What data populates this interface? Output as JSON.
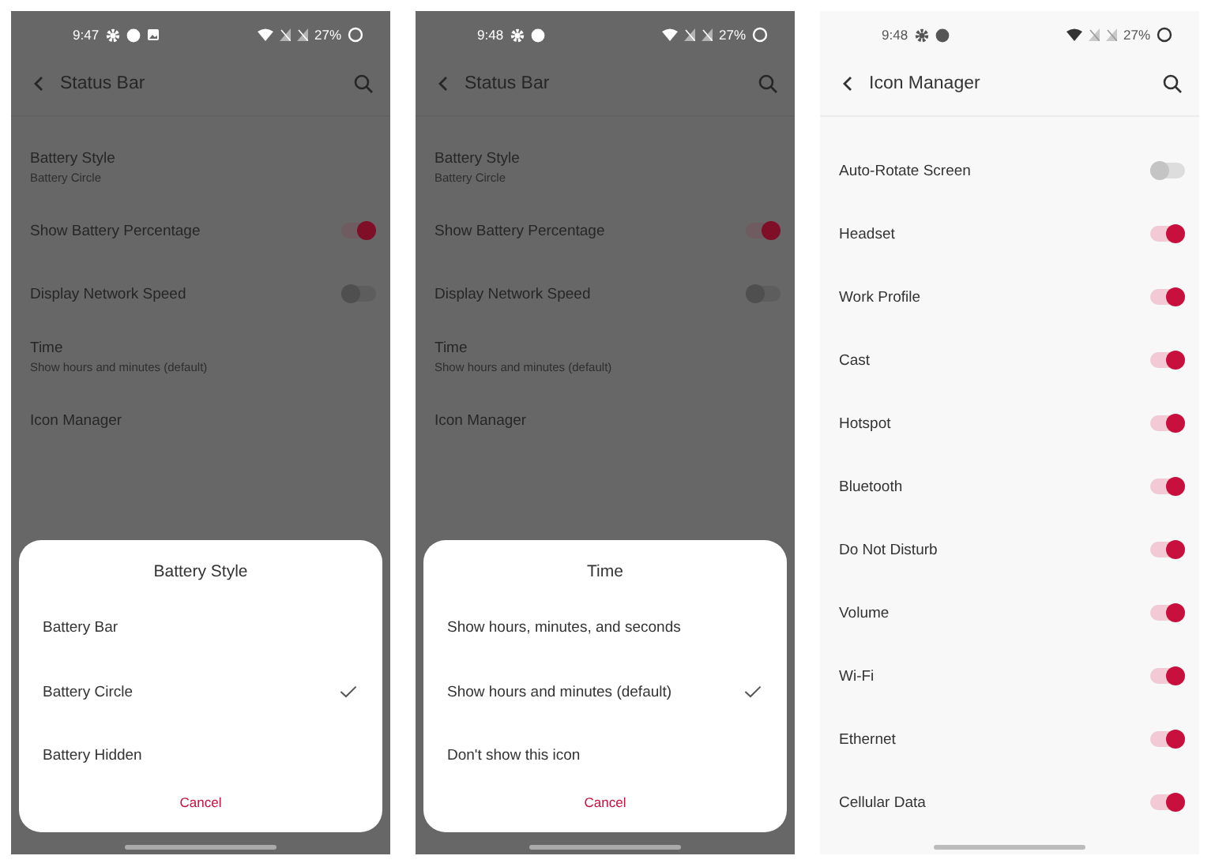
{
  "screens": [
    {
      "dimmed": true,
      "status_bar": {
        "time": "9:47",
        "notification_icons": [
          {
            "kind": "gear"
          },
          {
            "kind": "dot"
          },
          {
            "kind": "image"
          }
        ],
        "battery": "27%"
      },
      "header": {
        "title": "Status Bar"
      },
      "settings": [
        {
          "kind": "text",
          "label": "Battery Style",
          "summary": "Battery Circle"
        },
        {
          "kind": "switch",
          "label": "Show Battery Percentage",
          "on": true
        },
        {
          "kind": "switch",
          "label": "Display Network Speed",
          "on": false
        },
        {
          "kind": "text",
          "label": "Time",
          "summary": "Show hours and minutes (default)"
        },
        {
          "kind": "text",
          "label": "Icon Manager"
        }
      ],
      "dialog": {
        "title": "Battery Style",
        "options": [
          {
            "label": "Battery Bar",
            "selected": false
          },
          {
            "label": "Battery Circle",
            "selected": true
          },
          {
            "label": "Battery Hidden",
            "selected": false
          }
        ],
        "cancel": "Cancel"
      }
    },
    {
      "dimmed": true,
      "status_bar": {
        "time": "9:48",
        "notification_icons": [
          {
            "kind": "gear"
          },
          {
            "kind": "dot"
          }
        ],
        "battery": "27%"
      },
      "header": {
        "title": "Status Bar"
      },
      "settings": [
        {
          "kind": "text",
          "label": "Battery Style",
          "summary": "Battery Circle"
        },
        {
          "kind": "switch",
          "label": "Show Battery Percentage",
          "on": true
        },
        {
          "kind": "switch",
          "label": "Display Network Speed",
          "on": false
        },
        {
          "kind": "text",
          "label": "Time",
          "summary": "Show hours and minutes (default)"
        },
        {
          "kind": "text",
          "label": "Icon Manager"
        }
      ],
      "dialog": {
        "title": "Time",
        "options": [
          {
            "label": "Show hours, minutes, and seconds",
            "selected": false
          },
          {
            "label": "Show hours and minutes (default)",
            "selected": true
          },
          {
            "label": "Don't show this icon",
            "selected": false
          }
        ],
        "cancel": "Cancel"
      }
    },
    {
      "dimmed": false,
      "status_bar": {
        "time": "9:48",
        "notification_icons": [
          {
            "kind": "gear"
          },
          {
            "kind": "dot"
          }
        ],
        "battery": "27%"
      },
      "header": {
        "title": "Icon Manager"
      },
      "settings": [
        {
          "kind": "switch",
          "label": "Auto-Rotate Screen",
          "on": false
        },
        {
          "kind": "switch",
          "label": "Headset",
          "on": true
        },
        {
          "kind": "switch",
          "label": "Work Profile",
          "on": true
        },
        {
          "kind": "switch",
          "label": "Cast",
          "on": true
        },
        {
          "kind": "switch",
          "label": "Hotspot",
          "on": true
        },
        {
          "kind": "switch",
          "label": "Bluetooth",
          "on": true
        },
        {
          "kind": "switch",
          "label": "Do Not Disturb",
          "on": true
        },
        {
          "kind": "switch",
          "label": "Volume",
          "on": true
        },
        {
          "kind": "switch",
          "label": "Wi-Fi",
          "on": true
        },
        {
          "kind": "switch",
          "label": "Ethernet",
          "on": true
        },
        {
          "kind": "switch",
          "label": "Cellular Data",
          "on": true
        }
      ]
    }
  ]
}
